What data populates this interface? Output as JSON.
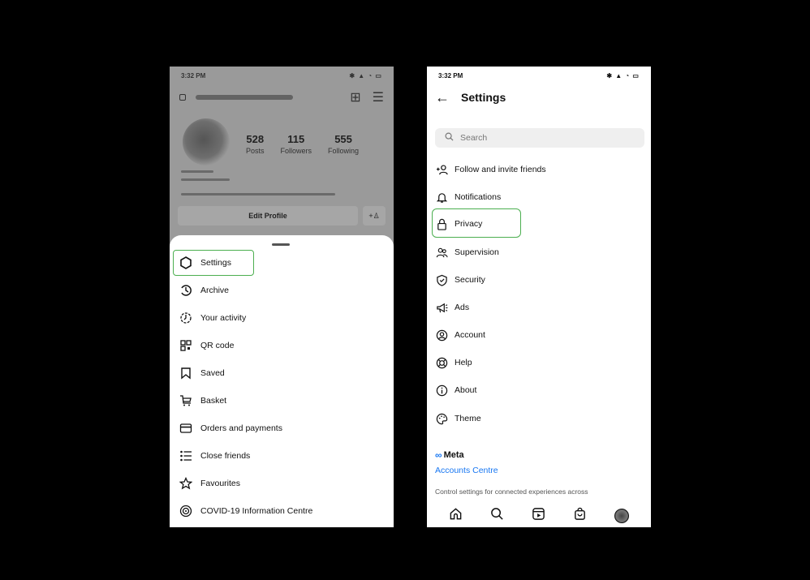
{
  "left_phone": {
    "status_time": "3:32 PM",
    "stats": [
      {
        "num": "528",
        "label": "Posts"
      },
      {
        "num": "115",
        "label": "Followers"
      },
      {
        "num": "555",
        "label": "Following"
      }
    ],
    "edit_profile_label": "Edit Profile",
    "menu": [
      {
        "label": "Settings",
        "icon": "gear-icon"
      },
      {
        "label": "Archive",
        "icon": "archive-icon"
      },
      {
        "label": "Your activity",
        "icon": "activity-icon"
      },
      {
        "label": "QR code",
        "icon": "qr-code-icon"
      },
      {
        "label": "Saved",
        "icon": "bookmark-icon"
      },
      {
        "label": "Basket",
        "icon": "cart-icon"
      },
      {
        "label": "Orders and payments",
        "icon": "card-icon"
      },
      {
        "label": "Close friends",
        "icon": "list-icon"
      },
      {
        "label": "Favourites",
        "icon": "star-icon"
      },
      {
        "label": "COVID-19 Information Centre",
        "icon": "covid-icon"
      }
    ],
    "highlight_color": "#4caf50"
  },
  "right_phone": {
    "status_time": "3:32 PM",
    "title": "Settings",
    "search_placeholder": "Search",
    "items": [
      {
        "label": "Follow and invite friends",
        "icon": "add-person-icon"
      },
      {
        "label": "Notifications",
        "icon": "bell-icon"
      },
      {
        "label": "Privacy",
        "icon": "lock-icon"
      },
      {
        "label": "Supervision",
        "icon": "supervision-icon"
      },
      {
        "label": "Security",
        "icon": "shield-icon"
      },
      {
        "label": "Ads",
        "icon": "megaphone-icon"
      },
      {
        "label": "Account",
        "icon": "account-icon"
      },
      {
        "label": "Help",
        "icon": "help-icon"
      },
      {
        "label": "About",
        "icon": "info-icon"
      },
      {
        "label": "Theme",
        "icon": "palette-icon"
      }
    ],
    "meta_label": "Meta",
    "accounts_centre_label": "Accounts Centre",
    "meta_description": "Control settings for connected experiences across",
    "accent_color": "#1877f2",
    "highlight_color": "#4caf50"
  }
}
